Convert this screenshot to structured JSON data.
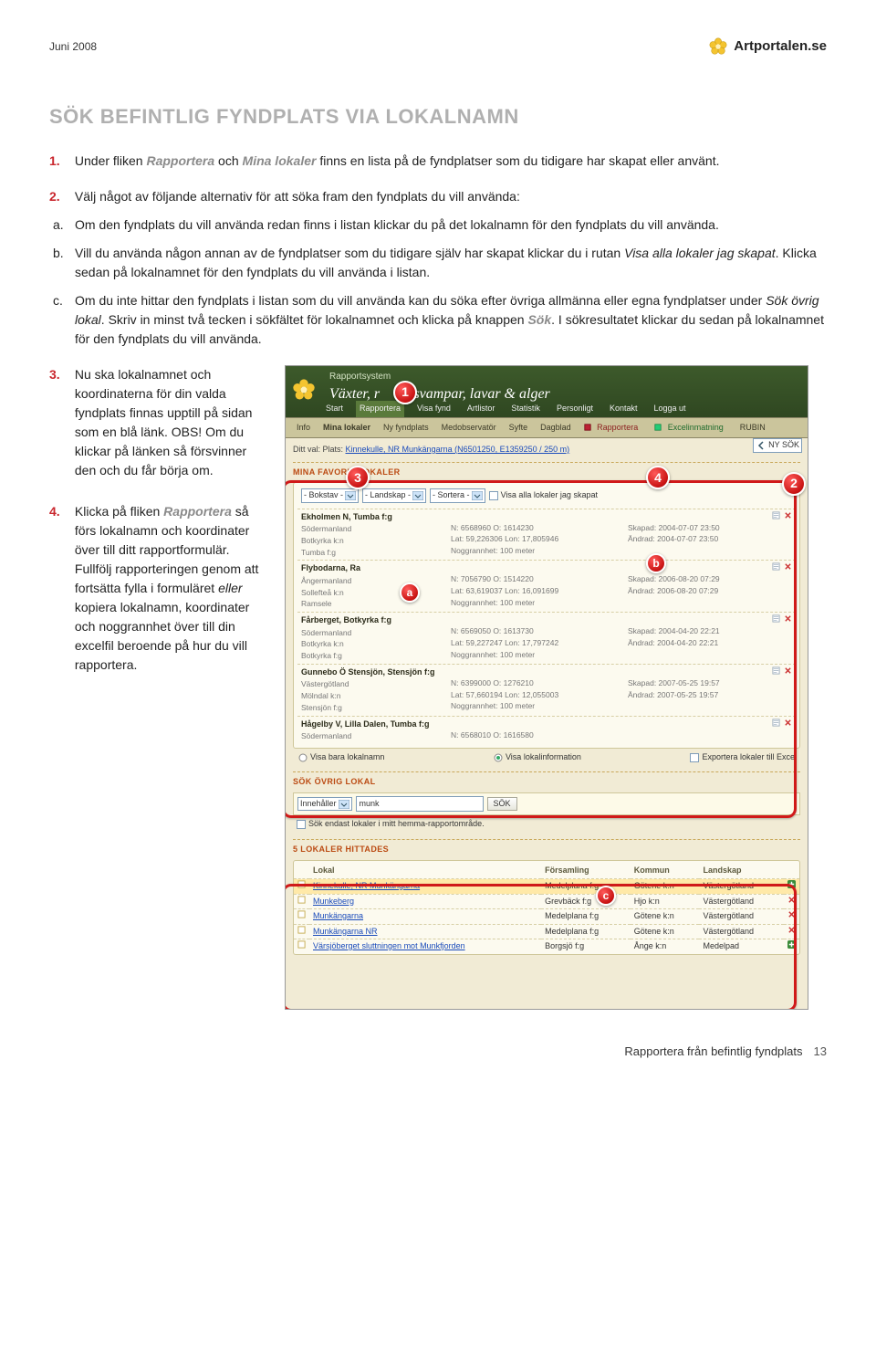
{
  "header": {
    "date": "Juni 2008",
    "brand": "Artportalen.se"
  },
  "title": "SÖK BEFINTLIG FYNDPLATS VIA LOKALNAMN",
  "steps": {
    "s1": {
      "num": "1.",
      "pre": "Under fliken ",
      "em1": "Rapportera",
      "mid": " och ",
      "em2": "Mina lokaler",
      "post": " finns en lista på de fyndplatser som du tidigare har skapat eller använt."
    },
    "s2": {
      "num": "2.",
      "text": "Välj något av följande alternativ för att söka fram den fyndplats du vill använda:"
    },
    "sub": {
      "a": {
        "let": "a.",
        "text": "Om den fyndplats du vill använda redan finns i listan klickar du på det lokalnamn för den fyndplats du vill använda."
      },
      "b": {
        "let": "b.",
        "pre": "Vill du använda någon annan av de fyndplatser som du tidigare själv har skapat klickar du i rutan ",
        "em": "Visa alla lokaler jag skapat",
        "post": ". Klicka sedan på lokalnamnet för den fyndplats du vill använda i listan."
      },
      "c": {
        "let": "c.",
        "pre": "Om du inte hittar den fyndplats i listan som du vill använda kan du söka efter övriga allmänna eller egna fyndplatser under ",
        "em1": "Sök övrig lokal",
        "mid": ". Skriv in minst två tecken i sökfältet för lokalnamnet och klicka på knappen ",
        "em2": "Sök",
        "post": ". I sökresultatet klickar du sedan på lokalnamnet för den fyndplats du vill använda."
      }
    },
    "s3": {
      "num": "3.",
      "text": "Nu ska lokalnamnet och koordinaterna för din valda fyndplats finnas upptill på sidan som en blå länk. OBS! Om du klickar på länken så försvinner den och du får börja om."
    },
    "s4": {
      "num": "4.",
      "pre": "Klicka på fliken ",
      "em": "Rapportera",
      "mid": " så förs lokalnamn och koordinater över till ditt rapportformulär. Fullfölj rapporteringen genom att fortsätta fylla i formuläret ",
      "em2word": "eller",
      "post": " kopiera lokalnamn, koordinater och noggrannhet över till din excelfil beroende på hur du vill rapportera."
    }
  },
  "screenshot": {
    "system": "Rapportsystem",
    "headline_a": "Växter, r",
    "headline_b": "svampar, lavar & alger",
    "nav": [
      "Start",
      "Rapportera",
      "Visa fynd",
      "Artlistor",
      "Statistik",
      "Personligt",
      "Kontakt",
      "Logga ut"
    ],
    "subnav": {
      "info": "Info",
      "mina": "Mina lokaler",
      "ny": "Ny fyndplats",
      "med": "Medobservatör",
      "syfte": "Syfte",
      "dag": "Dagblad",
      "rapp": "Rapportera",
      "excel": "Excelinmatning",
      "rubin": "RUBIN"
    },
    "crumb_pre": "Ditt val: Plats: ",
    "crumb_link": "Kinnekulle, NR Munkängarna (N6501250, E1359250 / 250 m)",
    "ny_sok": "NY SÖK",
    "sec_fav": "MINA FAVORIT-LOKALER",
    "sel_bokstav": "- Bokstav -",
    "sel_landskap": "- Landskap -",
    "sel_sortera": "- Sortera -",
    "chk_visa": "Visa alla lokaler jag skapat",
    "items": [
      {
        "name": "Ekholmen N, Tumba f:g",
        "r1": "Södermanland",
        "r2": "Botkyrka k:n",
        "r3": "Tumba f:g",
        "c1": "N: 6568960 O: 1614230",
        "c2": "Lat: 59,226306 Lon: 17,805946",
        "c3": "Noggrannhet: 100 meter",
        "d1": "Skapad: 2004-07-07 23:50",
        "d2": "Ändrad: 2004-07-07 23:50"
      },
      {
        "name": "Flybodarna, Ra",
        "r1": "Ångermanland",
        "r2": "Sollefteå k:n",
        "r3": "Ramsele",
        "c1": "N: 7056790 O: 1514220",
        "c2": "Lat: 63,619037 Lon: 16,091699",
        "c3": "Noggrannhet: 100 meter",
        "d1": "Skapad: 2006-08-20 07:29",
        "d2": "Ändrad: 2006-08-20 07:29"
      },
      {
        "name": "Fårberget, Botkyrka f:g",
        "r1": "Södermanland",
        "r2": "Botkyrka k:n",
        "r3": "Botkyrka f:g",
        "c1": "N: 6569050 O: 1613730",
        "c2": "Lat: 59,227247 Lon: 17,797242",
        "c3": "Noggrannhet: 100 meter",
        "d1": "Skapad: 2004-04-20 22:21",
        "d2": "Ändrad: 2004-04-20 22:21"
      },
      {
        "name": "Gunnebo Ö Stensjön, Stensjön f:g",
        "r1": "Västergötland",
        "r2": "Mölndal k:n",
        "r3": "Stensjön f:g",
        "c1": "N: 6399000 O: 1276210",
        "c2": "Lat: 57,660194 Lon: 12,055003",
        "c3": "Noggrannhet: 100 meter",
        "d1": "Skapad: 2007-05-25 19:57",
        "d2": "Ändrad: 2007-05-25 19:57"
      },
      {
        "name": "Hågelby V, Lilla Dalen, Tumba f:g",
        "r1": "Södermanland",
        "r2": "",
        "r3": "",
        "c1": "N: 6568010 O: 1616580",
        "c2": "",
        "c3": "",
        "d1": "",
        "d2": ""
      }
    ],
    "radio1": "Visa bara lokalnamn",
    "radio2": "Visa lokalinformation",
    "chk_exp": "Exportera lokaler till Exce",
    "sec_sok": "SÖK ÖVRIG LOKAL",
    "innehaller": "Innehåller",
    "sokval": "munk",
    "sokbtn": "SÖK",
    "chk_hemma": "Sök endast lokaler i mitt hemma-rapportområde.",
    "sec_res": "5 LOKALER HITTADES",
    "th": {
      "lokal": "Lokal",
      "fors": "Församling",
      "kommun": "Kommun",
      "land": "Landskap"
    },
    "rows": [
      {
        "l": "Kinnekulle, NR Munkängarna",
        "f": "Medelplana f:g",
        "k": "Götene k:n",
        "ld": "Västergötland",
        "plus": true,
        "hi": true
      },
      {
        "l": "Munkeberg",
        "f": "Grevbäck f:g",
        "k": "Hjo k:n",
        "ld": "Västergötland",
        "plus": false,
        "hi": false
      },
      {
        "l": "Munkängarna",
        "f": "Medelplana f:g",
        "k": "Götene k:n",
        "ld": "Västergötland",
        "plus": false,
        "hi": false
      },
      {
        "l": "Munkängarna NR",
        "f": "Medelplana f:g",
        "k": "Götene k:n",
        "ld": "Västergötland",
        "plus": false,
        "hi": false
      },
      {
        "l": "Värsjöberget sluttningen mot Munkfjorden",
        "f": "Borgsjö f:g",
        "k": "Ånge k:n",
        "ld": "Medelpad",
        "plus": true,
        "hi": false
      }
    ],
    "markers": {
      "m1": "1",
      "m2": "2",
      "m3": "3",
      "m4": "4",
      "a": "a",
      "b": "b",
      "c": "c"
    }
  },
  "footer": {
    "text": "Rapportera från befintlig fyndplats",
    "page": "13"
  }
}
